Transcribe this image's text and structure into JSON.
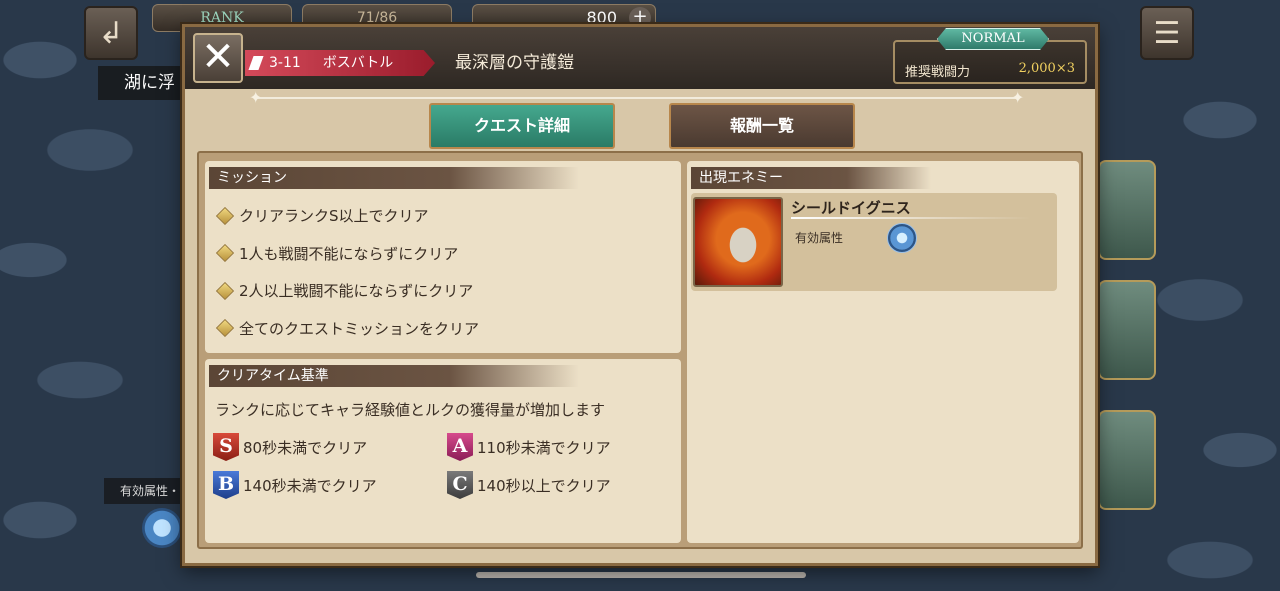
{
  "background": {
    "rank_label": "RANK",
    "stamina": "71/86",
    "currency": "800",
    "area_label": "湖に浮",
    "left_attr_label": "有効属性・"
  },
  "header": {
    "stage_code": "3-11",
    "stage_type": "ボスバトル",
    "title": "最深層の守護鎧",
    "difficulty": "NORMAL",
    "power_label": "推奨戦闘力",
    "power_value": "2,000×3"
  },
  "tabs": [
    {
      "label": "クエスト詳細",
      "active": true
    },
    {
      "label": "報酬一覧",
      "active": false
    }
  ],
  "mission": {
    "header": "ミッション",
    "items": [
      "クリアランクS以上でクリア",
      "1人も戦闘不能にならずにクリア",
      "2人以上戦闘不能にならずにクリア",
      "全てのクエストミッションをクリア"
    ]
  },
  "cleartime": {
    "header": "クリアタイム基準",
    "description": "ランクに応じてキャラ経験値とルクの獲得量が増加します",
    "ranks": [
      {
        "rank": "S",
        "text": "80秒未満でクリア"
      },
      {
        "rank": "A",
        "text": "110秒未満でクリア"
      },
      {
        "rank": "B",
        "text": "140秒未満でクリア"
      },
      {
        "rank": "C",
        "text": "140秒以上でクリア"
      }
    ]
  },
  "enemy": {
    "header": "出現エネミー",
    "name": "シールドイグニス",
    "attr_label": "有効属性",
    "attr_icon": "water-element-icon"
  },
  "colors": {
    "tab_active": "#2a7b66",
    "tab_inactive": "#4a3a30",
    "stage_tag": "#9a1c2c",
    "power_value": "#f0d060"
  }
}
